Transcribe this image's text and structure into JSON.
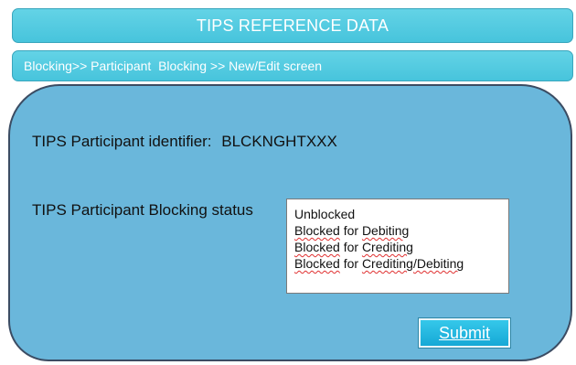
{
  "header": {
    "title": "TIPS REFERENCE DATA",
    "breadcrumb": "Blocking>> Participant  Blocking >> New/Edit screen"
  },
  "form": {
    "identifier_label": "TIPS Participant identifier:",
    "identifier_value": "BLCKNGHTXXX",
    "status_label": "TIPS Participant Blocking status",
    "status_options": [
      {
        "parts": [
          {
            "text": "Unblocked",
            "squiggle": false
          }
        ]
      },
      {
        "parts": [
          {
            "text": "Blocked",
            "squiggle": true
          },
          {
            "text": " for ",
            "squiggle": false
          },
          {
            "text": "Debiting",
            "squiggle": true
          }
        ]
      },
      {
        "parts": [
          {
            "text": "Blocked",
            "squiggle": true
          },
          {
            "text": " for ",
            "squiggle": false
          },
          {
            "text": "Crediting",
            "squiggle": true
          }
        ]
      },
      {
        "parts": [
          {
            "text": "Blocked",
            "squiggle": true
          },
          {
            "text": " for ",
            "squiggle": false
          },
          {
            "text": "Crediting/Debiting",
            "squiggle": true
          }
        ]
      }
    ],
    "submit_label": "Submit"
  },
  "colors": {
    "header_bar": "#4fcbe0",
    "panel": "#6ab7db",
    "panel_border": "#3b4c63",
    "button": "#1fb3df",
    "spellcheck": "#e03030"
  }
}
